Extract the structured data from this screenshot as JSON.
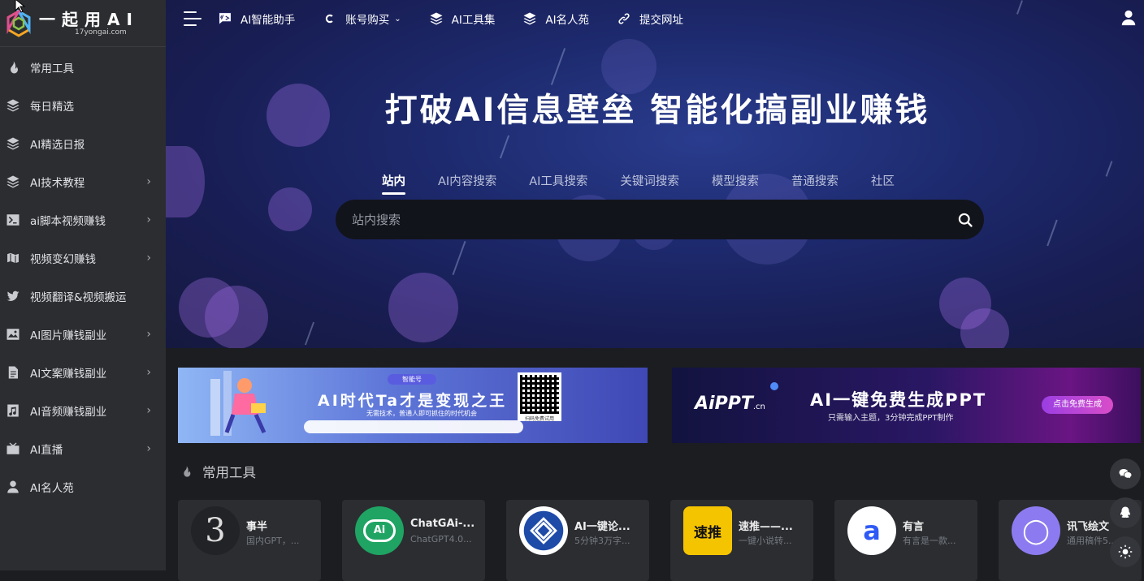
{
  "logo": {
    "name": "一起用AI",
    "domain": "17yongai.com"
  },
  "sidebar": {
    "items": [
      {
        "label": "常用工具",
        "icon": "fire-icon",
        "has_submenu": false
      },
      {
        "label": "每日精选",
        "icon": "layers-icon",
        "has_submenu": false
      },
      {
        "label": "AI精选日报",
        "icon": "layers-icon",
        "has_submenu": false
      },
      {
        "label": "AI技术教程",
        "icon": "layers-icon",
        "has_submenu": true
      },
      {
        "label": "ai脚本视频赚钱",
        "icon": "terminal-icon",
        "has_submenu": true
      },
      {
        "label": "视频变幻赚钱",
        "icon": "map-icon",
        "has_submenu": true
      },
      {
        "label": "视频翻译&视频搬运",
        "icon": "twitter-icon",
        "has_submenu": false
      },
      {
        "label": "AI图片赚钱副业",
        "icon": "image-icon",
        "has_submenu": true
      },
      {
        "label": "AI文案赚钱副业",
        "icon": "document-icon",
        "has_submenu": true
      },
      {
        "label": "AI音频赚钱副业",
        "icon": "music-icon",
        "has_submenu": true
      },
      {
        "label": "AI直播",
        "icon": "tv-icon",
        "has_submenu": true
      },
      {
        "label": "AI名人苑",
        "icon": "user-icon",
        "has_submenu": false
      }
    ]
  },
  "topnav": {
    "items": [
      {
        "label": "AI智能助手",
        "icon": "chat-code-icon"
      },
      {
        "label": "账号购买",
        "icon": "c-logo-icon",
        "dropdown": true
      },
      {
        "label": "AI工具集",
        "icon": "layers-icon"
      },
      {
        "label": "AI名人苑",
        "icon": "layers-icon"
      },
      {
        "label": "提交网址",
        "icon": "link-icon"
      }
    ]
  },
  "hero": {
    "title": "打破AI信息壁垒 智能化搞副业赚钱",
    "tabs": [
      "站内",
      "AI内容搜索",
      "AI工具搜索",
      "关键词搜索",
      "模型搜索",
      "普通搜索",
      "社区"
    ],
    "active_tab": "站内",
    "search_placeholder": "站内搜索"
  },
  "banners": {
    "left": {
      "tag": "智能号",
      "title": "AI时代Ta才是变现之王",
      "subtitle": "无需技术，普通人即可抓住的时代机会",
      "qr_caption": "扫码免费试用"
    },
    "right": {
      "logo": "AiPPT",
      "logo_suffix": ".cn",
      "title": "AI一键免费生成PPT",
      "subtitle": "只需输入主题，3分钟完成PPT制作",
      "button": "点击免费生成"
    }
  },
  "section": {
    "title": "常用工具"
  },
  "cards": [
    {
      "name": "事半",
      "desc": "国内GPT，...",
      "logo_bg": "#222326",
      "logo_fg": "#ddd",
      "logo_text": "3"
    },
    {
      "name": "ChatGAi-...",
      "desc": "ChatGPT4.0...",
      "logo_bg": "#1fa463",
      "logo_fg": "#fff",
      "logo_text": "Ai"
    },
    {
      "name": "AI一键论...",
      "desc": "5分钟3万字...",
      "logo_bg": "#ffffff",
      "logo_fg": "#1e4aa8",
      "logo_text": "⛛"
    },
    {
      "name": "速推——...",
      "desc": "一键小说转...",
      "logo_bg": "#f5c400",
      "logo_fg": "#111",
      "logo_text": "速推"
    },
    {
      "name": "有言",
      "desc": "有言是一款...",
      "logo_bg": "#ffffff",
      "logo_fg": "#2f5af5",
      "logo_text": "a"
    },
    {
      "name": "讯飞绘文",
      "desc": "通用稿件5...",
      "logo_bg": "#8c7bf0",
      "logo_fg": "#fff",
      "logo_text": "◯"
    }
  ],
  "float_buttons": [
    "wechat-icon",
    "qq-icon",
    "sun-icon"
  ]
}
